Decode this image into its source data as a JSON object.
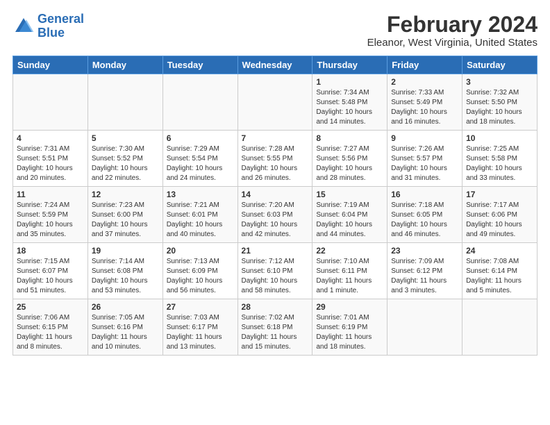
{
  "header": {
    "logo_line1": "General",
    "logo_line2": "Blue",
    "main_title": "February 2024",
    "subtitle": "Eleanor, West Virginia, United States"
  },
  "days_of_week": [
    "Sunday",
    "Monday",
    "Tuesday",
    "Wednesday",
    "Thursday",
    "Friday",
    "Saturday"
  ],
  "weeks": [
    [
      {
        "num": "",
        "info": ""
      },
      {
        "num": "",
        "info": ""
      },
      {
        "num": "",
        "info": ""
      },
      {
        "num": "",
        "info": ""
      },
      {
        "num": "1",
        "info": "Sunrise: 7:34 AM\nSunset: 5:48 PM\nDaylight: 10 hours\nand 14 minutes."
      },
      {
        "num": "2",
        "info": "Sunrise: 7:33 AM\nSunset: 5:49 PM\nDaylight: 10 hours\nand 16 minutes."
      },
      {
        "num": "3",
        "info": "Sunrise: 7:32 AM\nSunset: 5:50 PM\nDaylight: 10 hours\nand 18 minutes."
      }
    ],
    [
      {
        "num": "4",
        "info": "Sunrise: 7:31 AM\nSunset: 5:51 PM\nDaylight: 10 hours\nand 20 minutes."
      },
      {
        "num": "5",
        "info": "Sunrise: 7:30 AM\nSunset: 5:52 PM\nDaylight: 10 hours\nand 22 minutes."
      },
      {
        "num": "6",
        "info": "Sunrise: 7:29 AM\nSunset: 5:54 PM\nDaylight: 10 hours\nand 24 minutes."
      },
      {
        "num": "7",
        "info": "Sunrise: 7:28 AM\nSunset: 5:55 PM\nDaylight: 10 hours\nand 26 minutes."
      },
      {
        "num": "8",
        "info": "Sunrise: 7:27 AM\nSunset: 5:56 PM\nDaylight: 10 hours\nand 28 minutes."
      },
      {
        "num": "9",
        "info": "Sunrise: 7:26 AM\nSunset: 5:57 PM\nDaylight: 10 hours\nand 31 minutes."
      },
      {
        "num": "10",
        "info": "Sunrise: 7:25 AM\nSunset: 5:58 PM\nDaylight: 10 hours\nand 33 minutes."
      }
    ],
    [
      {
        "num": "11",
        "info": "Sunrise: 7:24 AM\nSunset: 5:59 PM\nDaylight: 10 hours\nand 35 minutes."
      },
      {
        "num": "12",
        "info": "Sunrise: 7:23 AM\nSunset: 6:00 PM\nDaylight: 10 hours\nand 37 minutes."
      },
      {
        "num": "13",
        "info": "Sunrise: 7:21 AM\nSunset: 6:01 PM\nDaylight: 10 hours\nand 40 minutes."
      },
      {
        "num": "14",
        "info": "Sunrise: 7:20 AM\nSunset: 6:03 PM\nDaylight: 10 hours\nand 42 minutes."
      },
      {
        "num": "15",
        "info": "Sunrise: 7:19 AM\nSunset: 6:04 PM\nDaylight: 10 hours\nand 44 minutes."
      },
      {
        "num": "16",
        "info": "Sunrise: 7:18 AM\nSunset: 6:05 PM\nDaylight: 10 hours\nand 46 minutes."
      },
      {
        "num": "17",
        "info": "Sunrise: 7:17 AM\nSunset: 6:06 PM\nDaylight: 10 hours\nand 49 minutes."
      }
    ],
    [
      {
        "num": "18",
        "info": "Sunrise: 7:15 AM\nSunset: 6:07 PM\nDaylight: 10 hours\nand 51 minutes."
      },
      {
        "num": "19",
        "info": "Sunrise: 7:14 AM\nSunset: 6:08 PM\nDaylight: 10 hours\nand 53 minutes."
      },
      {
        "num": "20",
        "info": "Sunrise: 7:13 AM\nSunset: 6:09 PM\nDaylight: 10 hours\nand 56 minutes."
      },
      {
        "num": "21",
        "info": "Sunrise: 7:12 AM\nSunset: 6:10 PM\nDaylight: 10 hours\nand 58 minutes."
      },
      {
        "num": "22",
        "info": "Sunrise: 7:10 AM\nSunset: 6:11 PM\nDaylight: 11 hours\nand 1 minute."
      },
      {
        "num": "23",
        "info": "Sunrise: 7:09 AM\nSunset: 6:12 PM\nDaylight: 11 hours\nand 3 minutes."
      },
      {
        "num": "24",
        "info": "Sunrise: 7:08 AM\nSunset: 6:14 PM\nDaylight: 11 hours\nand 5 minutes."
      }
    ],
    [
      {
        "num": "25",
        "info": "Sunrise: 7:06 AM\nSunset: 6:15 PM\nDaylight: 11 hours\nand 8 minutes."
      },
      {
        "num": "26",
        "info": "Sunrise: 7:05 AM\nSunset: 6:16 PM\nDaylight: 11 hours\nand 10 minutes."
      },
      {
        "num": "27",
        "info": "Sunrise: 7:03 AM\nSunset: 6:17 PM\nDaylight: 11 hours\nand 13 minutes."
      },
      {
        "num": "28",
        "info": "Sunrise: 7:02 AM\nSunset: 6:18 PM\nDaylight: 11 hours\nand 15 minutes."
      },
      {
        "num": "29",
        "info": "Sunrise: 7:01 AM\nSunset: 6:19 PM\nDaylight: 11 hours\nand 18 minutes."
      },
      {
        "num": "",
        "info": ""
      },
      {
        "num": "",
        "info": ""
      }
    ]
  ]
}
